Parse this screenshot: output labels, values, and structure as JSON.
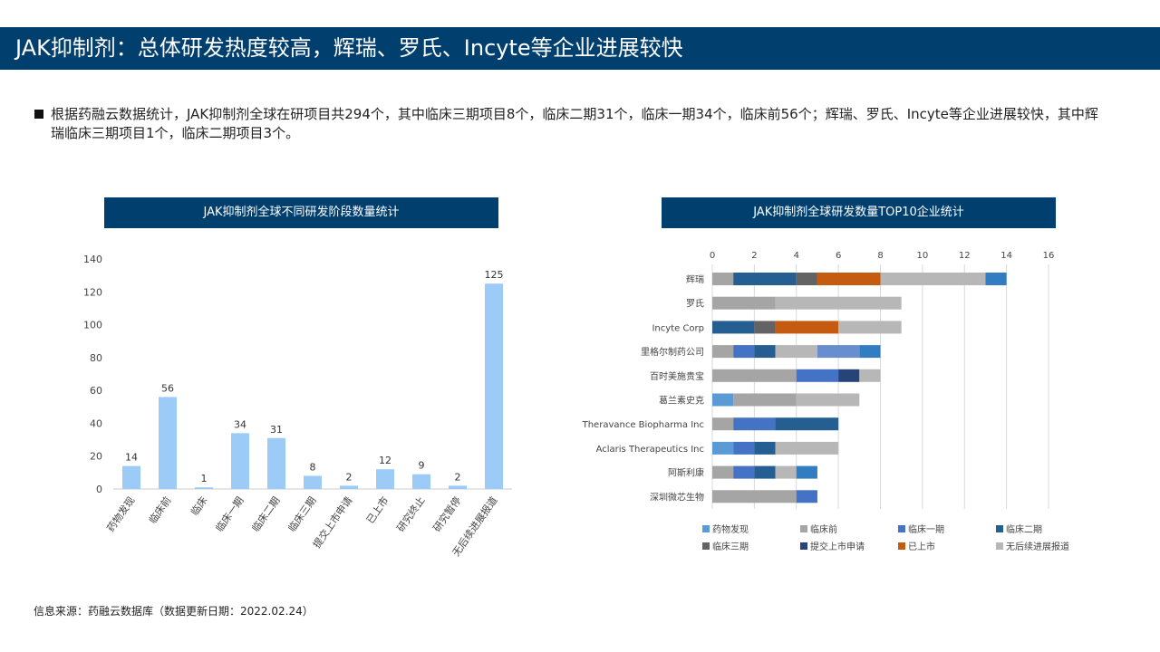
{
  "header": {
    "title": "JAK抑制剂：总体研发热度较高，辉瑞、罗氏、Incyte等企业进展较快"
  },
  "summary": "根据药融云数据统计，JAK抑制剂全球在研项目共294个，其中临床三期项目8个，临床二期31个，临床一期34个，临床前56个；辉瑞、罗氏、Incyte等企业进展较快，其中辉瑞临床三期项目1个，临床二期项目3个。",
  "source": "信息来源：药融云数据库（数据更新日期：2022.02.24）",
  "chart_data": [
    {
      "type": "bar",
      "title": "JAK抑制剂全球不同研发阶段数量统计",
      "categories": [
        "药物发现",
        "临床前",
        "临床",
        "临床一期",
        "临床二期",
        "临床三期",
        "提交上市申请",
        "已上市",
        "研究终止",
        "研究暂停",
        "无后续进展报道"
      ],
      "values": [
        14,
        56,
        1,
        34,
        31,
        8,
        2,
        12,
        9,
        2,
        125
      ],
      "ylim": [
        0,
        140
      ],
      "yticks": [
        0,
        20,
        40,
        60,
        80,
        100,
        120,
        140
      ],
      "color": "#9dcbf7"
    },
    {
      "type": "bar",
      "orientation": "horizontal",
      "stacked": true,
      "title": "JAK抑制剂全球研发数量TOP10企业统计",
      "xlim": [
        0,
        16
      ],
      "xticks": [
        0,
        2,
        4,
        6,
        8,
        10,
        12,
        14,
        16
      ],
      "legend_position": "bottom",
      "series": [
        {
          "key": "disc",
          "name": "药物发现",
          "color": "#5b9bd5"
        },
        {
          "key": "pre",
          "name": "临床前",
          "color": "#a5a5a5"
        },
        {
          "key": "p1",
          "name": "临床一期",
          "color": "#4472c4"
        },
        {
          "key": "p2",
          "name": "临床二期",
          "color": "#255e91"
        },
        {
          "key": "p3",
          "name": "临床三期",
          "color": "#636363"
        },
        {
          "key": "sub",
          "name": "提交上市申请",
          "color": "#264478"
        },
        {
          "key": "mkt",
          "name": "已上市",
          "color": "#c55a11"
        },
        {
          "key": "none",
          "name": "无后续进展报道",
          "color": "#b7b7b7"
        },
        {
          "key": "x1",
          "name": "",
          "color": "#698ed0"
        },
        {
          "key": "x2",
          "name": "",
          "color": "#327dc2"
        }
      ],
      "categories": [
        {
          "name": "辉瑞",
          "segments": [
            [
              "pre",
              1
            ],
            [
              "p2",
              3
            ],
            [
              "p3",
              1
            ],
            [
              "mkt",
              3
            ],
            [
              "none",
              5
            ],
            [
              "x2",
              1
            ]
          ]
        },
        {
          "name": "罗氏",
          "segments": [
            [
              "pre",
              3
            ],
            [
              "none",
              6
            ]
          ]
        },
        {
          "name": "Incyte Corp",
          "segments": [
            [
              "p2",
              2
            ],
            [
              "p3",
              1
            ],
            [
              "mkt",
              3
            ],
            [
              "none",
              3
            ]
          ]
        },
        {
          "name": "里格尔制药公司",
          "segments": [
            [
              "pre",
              1
            ],
            [
              "p1",
              1
            ],
            [
              "p2",
              1
            ],
            [
              "none",
              2
            ],
            [
              "x1",
              2
            ],
            [
              "x2",
              1
            ]
          ]
        },
        {
          "name": "百时美施贵宝",
          "segments": [
            [
              "pre",
              4
            ],
            [
              "p1",
              2
            ],
            [
              "sub",
              1
            ],
            [
              "none",
              1
            ]
          ]
        },
        {
          "name": "葛兰素史克",
          "segments": [
            [
              "disc",
              1
            ],
            [
              "pre",
              3
            ],
            [
              "none",
              3
            ]
          ]
        },
        {
          "name": "Theravance Biopharma Inc",
          "segments": [
            [
              "pre",
              1
            ],
            [
              "p1",
              2
            ],
            [
              "p2",
              3
            ]
          ]
        },
        {
          "name": "Aclaris  Therapeutics Inc",
          "segments": [
            [
              "disc",
              1
            ],
            [
              "p1",
              1
            ],
            [
              "p2",
              1
            ],
            [
              "none",
              3
            ]
          ]
        },
        {
          "name": "阿斯利康",
          "segments": [
            [
              "pre",
              1
            ],
            [
              "p1",
              1
            ],
            [
              "p2",
              1
            ],
            [
              "none",
              1
            ],
            [
              "x2",
              1
            ]
          ]
        },
        {
          "name": "深圳微芯生物",
          "segments": [
            [
              "pre",
              4
            ],
            [
              "p1",
              1
            ]
          ]
        }
      ]
    }
  ]
}
